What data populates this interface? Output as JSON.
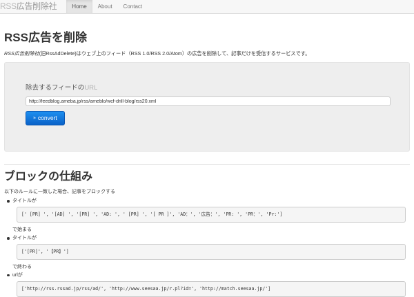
{
  "navbar": {
    "brand_muted": "RSS",
    "brand_main": "広告削除社",
    "items": [
      {
        "label": "Home",
        "active": true
      },
      {
        "label": "About",
        "active": false
      },
      {
        "label": "Contact",
        "active": false
      }
    ]
  },
  "hero": {
    "title": "RSS広告を削除",
    "lead_em": "RSS広告削除社",
    "lead_rest": "(旧RssAdDelete)はウェブ上のフィード（RSS 1.0/RSS 2.0/Atom）の広告を削除して、記事だけを受信するサービスです。"
  },
  "form": {
    "label_main": "除去するフィードの",
    "label_muted": "URL",
    "feed_url": "http://feedblog.ameba.jp/rss/ameblo/wcf-drill-blog/rss20.xml",
    "convert_icon": "»",
    "convert_label": "convert"
  },
  "blocking": {
    "title": "ブロックの仕組み",
    "description": "以下のルールに一致した場合、記事をブロックする",
    "rules": [
      {
        "label": "タイトルが",
        "code": "[' [PR] ', '[AD] ', '[PR] ', 'AD: ', ' [PR] ', '[ PR ]', 'AD：', '広告：', 'PR: ', 'PR：', 'Pr:']",
        "suffix": "で始まる"
      },
      {
        "label": "タイトルが",
        "code": "['[PR]', '【PR】']",
        "suffix": "で終わる"
      },
      {
        "label": "urlが",
        "code": "['http://rss.rssad.jp/rss/ad/', 'http://www.seesaa.jp/r.pl?id=', 'http://match.seesaa.jp/']",
        "suffix": ""
      }
    ]
  },
  "colors": {
    "accent": "#0a62c8",
    "navbar_bg": "#f7f7f7",
    "well_bg": "#eeeeee"
  }
}
